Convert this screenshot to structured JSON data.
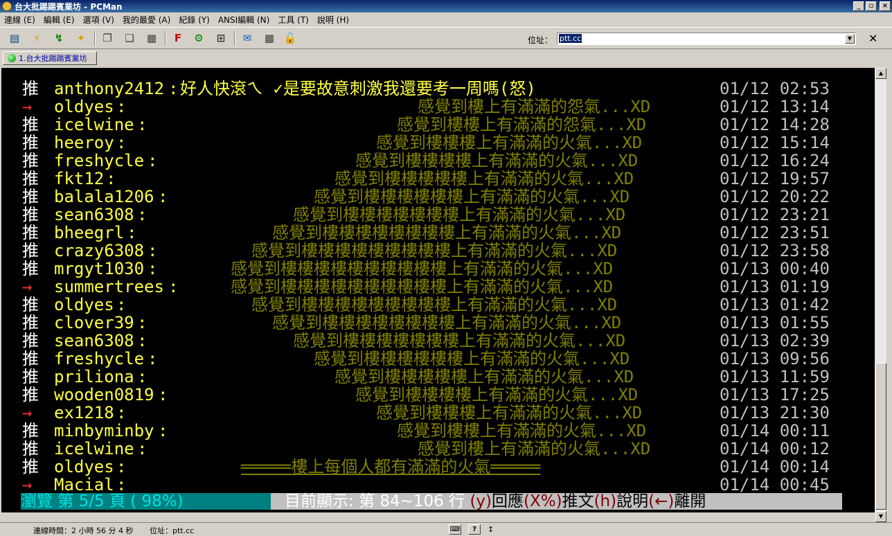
{
  "window": {
    "title": "台大批踢踢賓業坊 - PCMan",
    "minimize": "_",
    "restore": "▫",
    "close": "×"
  },
  "menu": [
    "連線 (E)",
    "編輯 (E)",
    "選項 (V)",
    "我的最愛 (A)",
    "紀錄 (Y)",
    "ANSI編輯 (N)",
    "工具 (T)",
    "說明 (H)"
  ],
  "toolbar": {
    "address_label": "位址：",
    "address_value": "ptt.cc",
    "close": "✕"
  },
  "tab": {
    "label": "1.台大批踢踢賓業坊"
  },
  "terminal": {
    "rows": [
      {
        "tag": "推",
        "kind": "push",
        "user": "anthony2412",
        "msg": "好人快滾ㄟ ✓是要故意刺激我還要考一周嗎(怒)",
        "date": "01/12 02:53"
      },
      {
        "tag": "→",
        "kind": "arrow",
        "user": "oldyes",
        "msg": "感覺到樓上有滿滿的怨氣...XD",
        "date": "01/12 13:14"
      },
      {
        "tag": "推",
        "kind": "push",
        "user": "icelwine",
        "msg": "感覺到樓樓上有滿滿的怨氣...XD",
        "date": "01/12 14:28"
      },
      {
        "tag": "推",
        "kind": "push",
        "user": "heeroy",
        "msg": "感覺到樓樓樓上有滿滿的火氣...XD",
        "date": "01/12 15:14"
      },
      {
        "tag": "推",
        "kind": "push",
        "user": "freshycle",
        "msg": "感覺到樓樓樓樓上有滿滿的火氣...XD",
        "date": "01/12 16:24"
      },
      {
        "tag": "推",
        "kind": "push",
        "user": "fkt12",
        "msg": "感覺到樓樓樓樓樓上有滿滿的火氣...XD",
        "date": "01/12 19:57"
      },
      {
        "tag": "推",
        "kind": "push",
        "user": "balala1206",
        "msg": "感覺到樓樓樓樓樓樓上有滿滿的火氣...XD",
        "date": "01/12 20:22"
      },
      {
        "tag": "推",
        "kind": "push",
        "user": "sean6308",
        "msg": "感覺到樓樓樓樓樓樓樓上有滿滿的火氣...XD",
        "date": "01/12 23:21"
      },
      {
        "tag": "推",
        "kind": "push",
        "user": "bheegrl",
        "msg": "感覺到樓樓樓樓樓樓樓樓上有滿滿的火氣...XD",
        "date": "01/12 23:51"
      },
      {
        "tag": "推",
        "kind": "push",
        "user": "crazy6308",
        "msg": "感覺到樓樓樓樓樓樓樓樓樓上有滿滿的火氣...XD",
        "date": "01/12 23:58"
      },
      {
        "tag": "推",
        "kind": "push",
        "user": "mrgyt1030",
        "msg": "感覺到樓樓樓樓樓樓樓樓樓樓上有滿滿的火氣...XD",
        "date": "01/13 00:40"
      },
      {
        "tag": "→",
        "kind": "arrow",
        "user": "summertrees",
        "msg": "感覺到樓樓樓樓樓樓樓樓樓樓上有滿滿的火氣...XD",
        "date": "01/13 01:19"
      },
      {
        "tag": "推",
        "kind": "push",
        "user": "oldyes",
        "msg": "感覺到樓樓樓樓樓樓樓樓樓上有滿滿的火氣...XD",
        "date": "01/13 01:42"
      },
      {
        "tag": "推",
        "kind": "push",
        "user": "clover39",
        "msg": "感覺到樓樓樓樓樓樓樓樓上有滿滿的火氣...XD",
        "date": "01/13 01:55"
      },
      {
        "tag": "推",
        "kind": "push",
        "user": "sean6308",
        "msg": "感覺到樓樓樓樓樓樓樓上有滿滿的火氣...XD",
        "date": "01/13 02:39"
      },
      {
        "tag": "推",
        "kind": "push",
        "user": "freshycle",
        "msg": "感覺到樓樓樓樓樓樓上有滿滿的火氣...XD",
        "date": "01/13 09:56"
      },
      {
        "tag": "推",
        "kind": "push",
        "user": "priliona",
        "msg": "感覺到樓樓樓樓樓上有滿滿的火氣...XD",
        "date": "01/13 11:59"
      },
      {
        "tag": "推",
        "kind": "push",
        "user": "wooden0819",
        "msg": "感覺到樓樓樓樓上有滿滿的火氣...XD",
        "date": "01/13 17:25"
      },
      {
        "tag": "→",
        "kind": "arrow",
        "user": "ex1218",
        "msg": "感覺到樓樓樓上有滿滿的火氣...XD",
        "date": "01/13 21:30"
      },
      {
        "tag": "推",
        "kind": "push",
        "user": "minbyminby",
        "msg": "感覺到樓樓上有滿滿的火氣...XD",
        "date": "01/14 00:11"
      },
      {
        "tag": "推",
        "kind": "push",
        "user": "icelwine",
        "msg": "感覺到樓上有滿滿的火氣...XD",
        "date": "01/14 00:12"
      },
      {
        "tag": "推",
        "kind": "push",
        "user": "oldyes",
        "msg": "═════樓上每個人都有滿滿的火氣═════",
        "date": "01/14 00:14"
      },
      {
        "tag": "→",
        "kind": "arrow",
        "user": "Macial",
        "msg": "",
        "date": "01/14 00:45"
      }
    ],
    "status_left": "瀏覽 第 5/5 頁 ( 98%)",
    "status_mid": "目前顯示: 第 84~106 行",
    "status_y": "(y)",
    "status_reply": "回應",
    "status_x": "(X%)",
    "status_push": "推文",
    "status_h": "(h)",
    "status_help": "說明",
    "status_back": "(←)",
    "status_leave": "離開"
  },
  "statusbar": {
    "connection_time": "連線時間：2 小時 56 分 4 秒",
    "address": "位址：ptt.cc",
    "help_icon": "?"
  }
}
